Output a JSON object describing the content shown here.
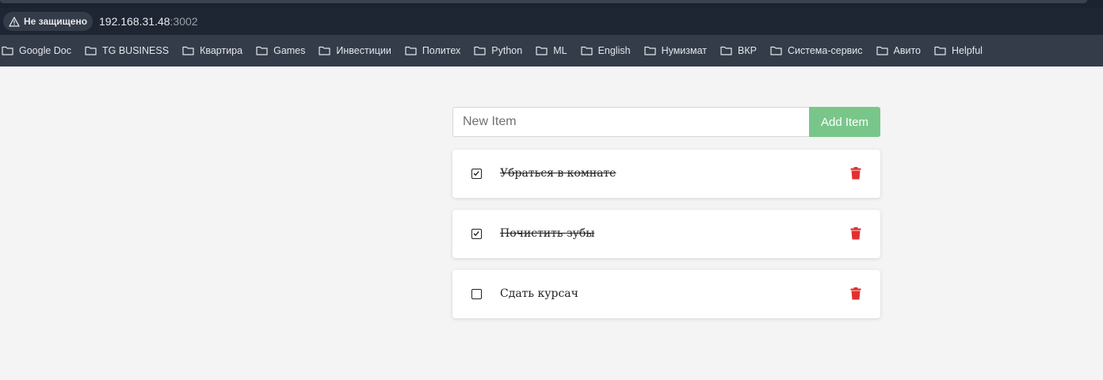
{
  "browser": {
    "security_label": "Не защищено",
    "url_host": "192.168.31.48",
    "url_port": ":3002"
  },
  "bookmarks": [
    "Google Doc",
    "TG BUSINESS",
    "Квартира",
    "Games",
    "Инвестиции",
    "Политех",
    "Python",
    "ML",
    "English",
    "Нумизмат",
    "ВКР",
    "Система-сервис",
    "Авито",
    "Helpful"
  ],
  "form": {
    "placeholder": "New Item",
    "add_label": "Add Item"
  },
  "items": [
    {
      "text": "Убраться в комнате",
      "checked": true
    },
    {
      "text": "Почистить зубы",
      "checked": true
    },
    {
      "text": "Сдать курсач",
      "checked": false
    }
  ],
  "colors": {
    "accent": "#79c68a",
    "delete": "#e03131"
  }
}
